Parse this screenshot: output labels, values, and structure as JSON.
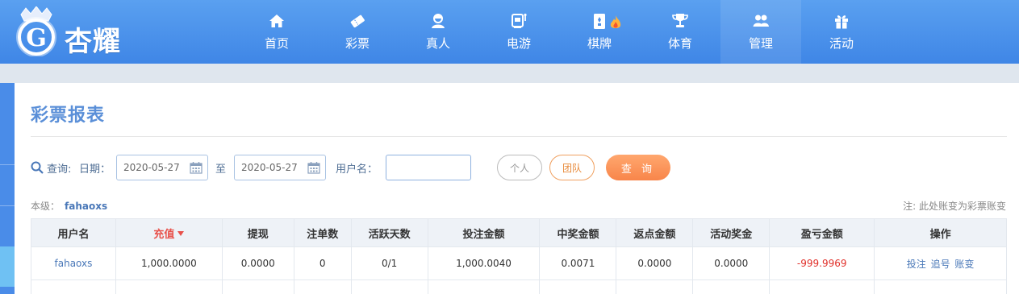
{
  "header": {
    "logo_text": "杏耀",
    "nav": [
      {
        "label": "首页",
        "icon": "home-icon"
      },
      {
        "label": "彩票",
        "icon": "lottery-ticket-icon"
      },
      {
        "label": "真人",
        "icon": "live-dealer-icon"
      },
      {
        "label": "电游",
        "icon": "slot-machine-icon"
      },
      {
        "label": "棋牌",
        "icon": "playing-card-icon",
        "badge_icon": "hot-flame-icon"
      },
      {
        "label": "体育",
        "icon": "trophy-icon"
      },
      {
        "label": "管理",
        "icon": "users-icon",
        "active": true
      },
      {
        "label": "活动",
        "icon": "gift-icon"
      }
    ]
  },
  "page": {
    "title": "彩票报表"
  },
  "filter": {
    "query_label": "查询:",
    "date_label": "日期：",
    "start_date": "2020-05-27",
    "to_label": "至",
    "end_date": "2020-05-27",
    "username_label": "用户名：",
    "username_value": "",
    "person_label": "个人",
    "team_label": "团队",
    "query_button": "查 询"
  },
  "level": {
    "label": "本级：",
    "user": "fahaoxs"
  },
  "note": "注: 此处账变为彩票账变",
  "table": {
    "headers": [
      "用户名",
      "充值",
      "提现",
      "注单数",
      "活跃天数",
      "投注金额",
      "中奖金额",
      "返点金额",
      "活动奖金",
      "盈亏金额",
      "操作"
    ],
    "sorted_column": "充值",
    "rows": [
      {
        "username": "fahaoxs",
        "recharge": "1,000.0000",
        "withdraw": "0.0000",
        "orders": "0",
        "active_days": "0/1",
        "bet_amount": "1,000.0040",
        "win_amount": "0.0071",
        "rebate_amount": "0.0000",
        "bonus": "0.0000",
        "profit_loss": "-999.9969",
        "actions": [
          "投注",
          "追号",
          "账变"
        ]
      }
    ]
  },
  "colors": {
    "header_blue": "#4a8ee8",
    "title_blue": "#5a8fd8",
    "negative_red": "#e0302a",
    "query_orange": "#f8854a"
  }
}
